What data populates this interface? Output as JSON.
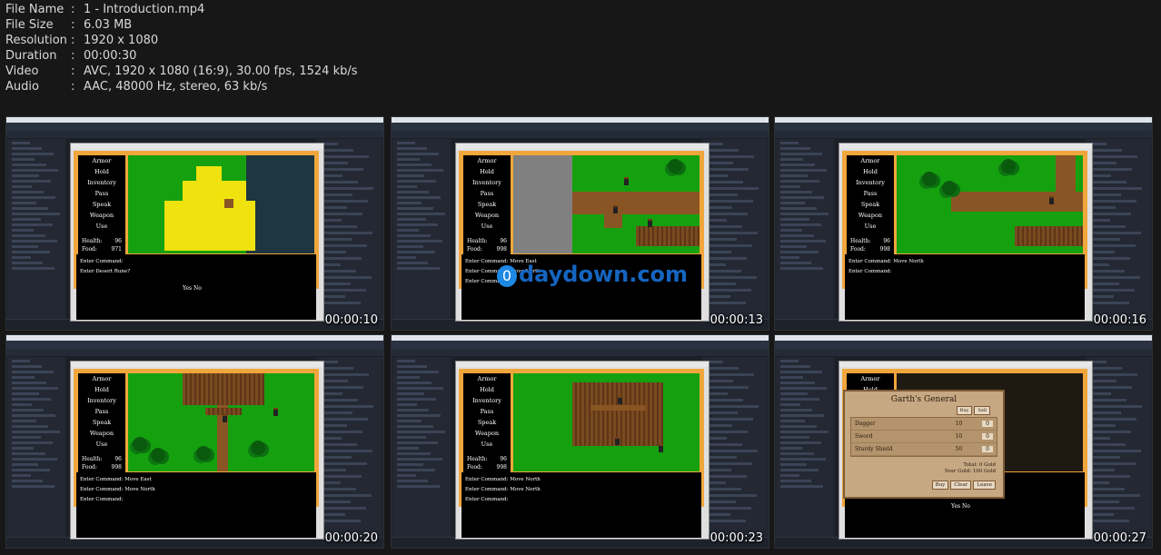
{
  "file_info": [
    {
      "key": "File Name",
      "value": "1 - Introduction.mp4"
    },
    {
      "key": "File Size",
      "value": "6.03 MB"
    },
    {
      "key": "Resolution",
      "value": "1920 x 1080"
    },
    {
      "key": "Duration",
      "value": "00:00:30"
    },
    {
      "key": "Video",
      "value": "AVC, 1920 x 1080 (16:9), 30.00 fps, 1524 kb/s"
    },
    {
      "key": "Audio",
      "value": "AAC, 48000 Hz, stereo, 63 kb/s"
    }
  ],
  "separator": ":",
  "menu_items": [
    "Armor",
    "Hold",
    "Inventory",
    "Pass",
    "Speak",
    "Weapon",
    "Use"
  ],
  "stat_labels": [
    "Health:",
    "Food:",
    "Gold:"
  ],
  "thumbnails": [
    {
      "timestamp": "00:00:10",
      "stats": [
        "96",
        "971",
        "100"
      ],
      "console": [
        "Enter Command:",
        "Enter Desert Rune?"
      ],
      "center_text": "Yes No"
    },
    {
      "timestamp": "00:00:13",
      "stats": [
        "96",
        "998",
        "100"
      ],
      "console": [
        "Enter Command: Move East",
        "Enter Command: Move North",
        "Enter Command:"
      ],
      "watermark": "daydown.com",
      "watermark_logo": "0"
    },
    {
      "timestamp": "00:00:16",
      "stats": [
        "96",
        "998",
        "100"
      ],
      "console": [
        "Enter Command: Move North",
        "Enter Command:"
      ]
    },
    {
      "timestamp": "00:00:20",
      "stats": [
        "96",
        "998",
        "100"
      ],
      "console": [
        "Enter Command: Move East",
        "Enter Command: Move North",
        "Enter Command:"
      ]
    },
    {
      "timestamp": "00:00:23",
      "stats": [
        "96",
        "998",
        "100"
      ],
      "console": [
        "Enter Command: Move North",
        "Enter Command: Move North",
        "Enter Command:"
      ]
    },
    {
      "timestamp": "00:00:27",
      "stats": [
        "96",
        "998",
        "100"
      ],
      "console": [],
      "center_text": "Yes No",
      "shop": {
        "title": "Garth's General",
        "tabs": [
          "Buy",
          "Sell"
        ],
        "items": [
          {
            "name": "Dagger",
            "price": "10",
            "qty": "0"
          },
          {
            "name": "Sword",
            "price": "10",
            "qty": "0"
          },
          {
            "name": "Sturdy Shield",
            "price": "50",
            "qty": "0"
          }
        ],
        "total": "Total: 0 Gold",
        "your_gold": "Your Gold: 100 Gold",
        "buttons": [
          "Buy",
          "Clear",
          "Leave"
        ]
      }
    }
  ],
  "colors": {
    "background": "#171717",
    "grass": "#15a00f",
    "frame": "#f1a63c",
    "watermark": "#1565c0"
  }
}
